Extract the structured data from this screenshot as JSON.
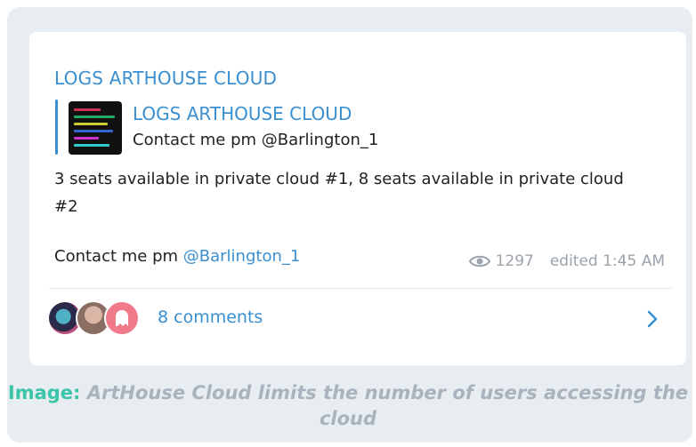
{
  "post": {
    "channel_name": "LOGS ARTHOUSE CLOUD",
    "quoted": {
      "title": "LOGS ARTHOUSE CLOUD",
      "text": "Contact me pm @Barlington_1"
    },
    "body": "3 seats available in private cloud #1, 8 seats available in private cloud #2",
    "contact_prefix": "Contact me pm ",
    "contact_mention": "@Barlington_1",
    "views": "1297",
    "edited": "edited 1:45 AM",
    "views_icon": "eye-icon"
  },
  "comments": {
    "label": "8 comments",
    "chevron_icon": "chevron-right-icon"
  },
  "caption": {
    "label": "Image:",
    "text": " ArtHouse Cloud limits the number of users accessing the cloud"
  },
  "colors": {
    "accent": "#3a8fd0",
    "caption_label": "#3cc4a9",
    "caption_text": "#a8b3bd",
    "frame_bg": "#e8edf1"
  }
}
